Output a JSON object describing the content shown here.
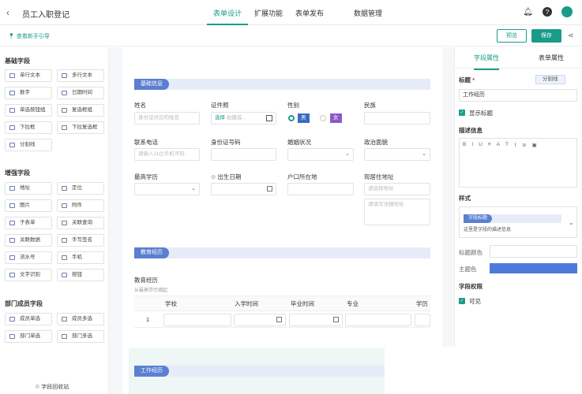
{
  "app": {
    "title": "员工入职登记"
  },
  "tabs": [
    {
      "label": "表单设计"
    },
    {
      "label": "扩展功能"
    },
    {
      "label": "表单发布"
    },
    {
      "label": "数据管理"
    }
  ],
  "toolbar": {
    "guide_label": "查看新手引导",
    "preview_label": "预览",
    "save_label": "保存"
  },
  "left_panel": {
    "basic_title": "基础字段",
    "basic": [
      "单行文本",
      "多行文本",
      "数字",
      "日期时间",
      "单选按钮组",
      "复选框组",
      "下拉框",
      "下拉复选框",
      "分割线"
    ],
    "enhanced_title": "增强字段",
    "enhanced": [
      "地址",
      "定位",
      "图片",
      "附件",
      "子表单",
      "关联查询",
      "关联数据",
      "手写签名",
      "流水号",
      "手机",
      "文字识别",
      "按钮"
    ],
    "dept_title": "部门成员字段",
    "dept": [
      "成员单选",
      "成员多选",
      "部门单选",
      "部门多选"
    ],
    "recycle_label": "字段回收站"
  },
  "form": {
    "section1": "基础信息",
    "name_label": "姓名",
    "name_placeholder": "身份证对应的姓名",
    "idtype_label": "证件照",
    "idtype_select": "选择",
    "idtype_hint": "拍摄或...",
    "gender_label": "性别",
    "gender_male": "男",
    "gender_female": "女",
    "ethnic_label": "民族",
    "phone_label": "联系电话",
    "phone_placeholder": "请输入11位手机号码",
    "idno_label": "身份证号码",
    "marital_label": "婚姻状况",
    "political_label": "政治面貌",
    "edu_label": "最高学历",
    "birth_label": "出生日期",
    "hukou_label": "户口所在地",
    "addr_label": "现居住地址",
    "addr_placeholder": "请选择地址",
    "addr_detail_placeholder": "请填写详细地址",
    "section2": "教育经历",
    "edu_sub_label": "教育经历",
    "edu_sub_hint": "从最高学历填起",
    "table_headers": [
      "学校",
      "入学时间",
      "毕业时间",
      "专业",
      "学历"
    ],
    "row_no": "1",
    "section3": "工作经历"
  },
  "right_panel": {
    "tab_field": "字段属性",
    "tab_form": "表单属性",
    "title_label": "标题",
    "required_star": "*",
    "divider_btn": "分割线",
    "title_value": "工作经历",
    "show_title": "显示标题",
    "desc_label": "描述信息",
    "toolbar_icons": [
      "B",
      "I",
      "U",
      "≡",
      "A",
      "T",
      "⌇",
      "⊘",
      "▣"
    ],
    "style_label": "样式",
    "style_tag": "字段标题",
    "style_desc": "这里是字段的描述信息",
    "title_color_label": "标题颜色",
    "theme_color_label": "主题色",
    "theme_color": "#4d7bdc",
    "perm_label": "字段权限",
    "visible_label": "可见"
  },
  "colors": {
    "accent": "#1a9b8a",
    "section": "#5b7fd1"
  }
}
